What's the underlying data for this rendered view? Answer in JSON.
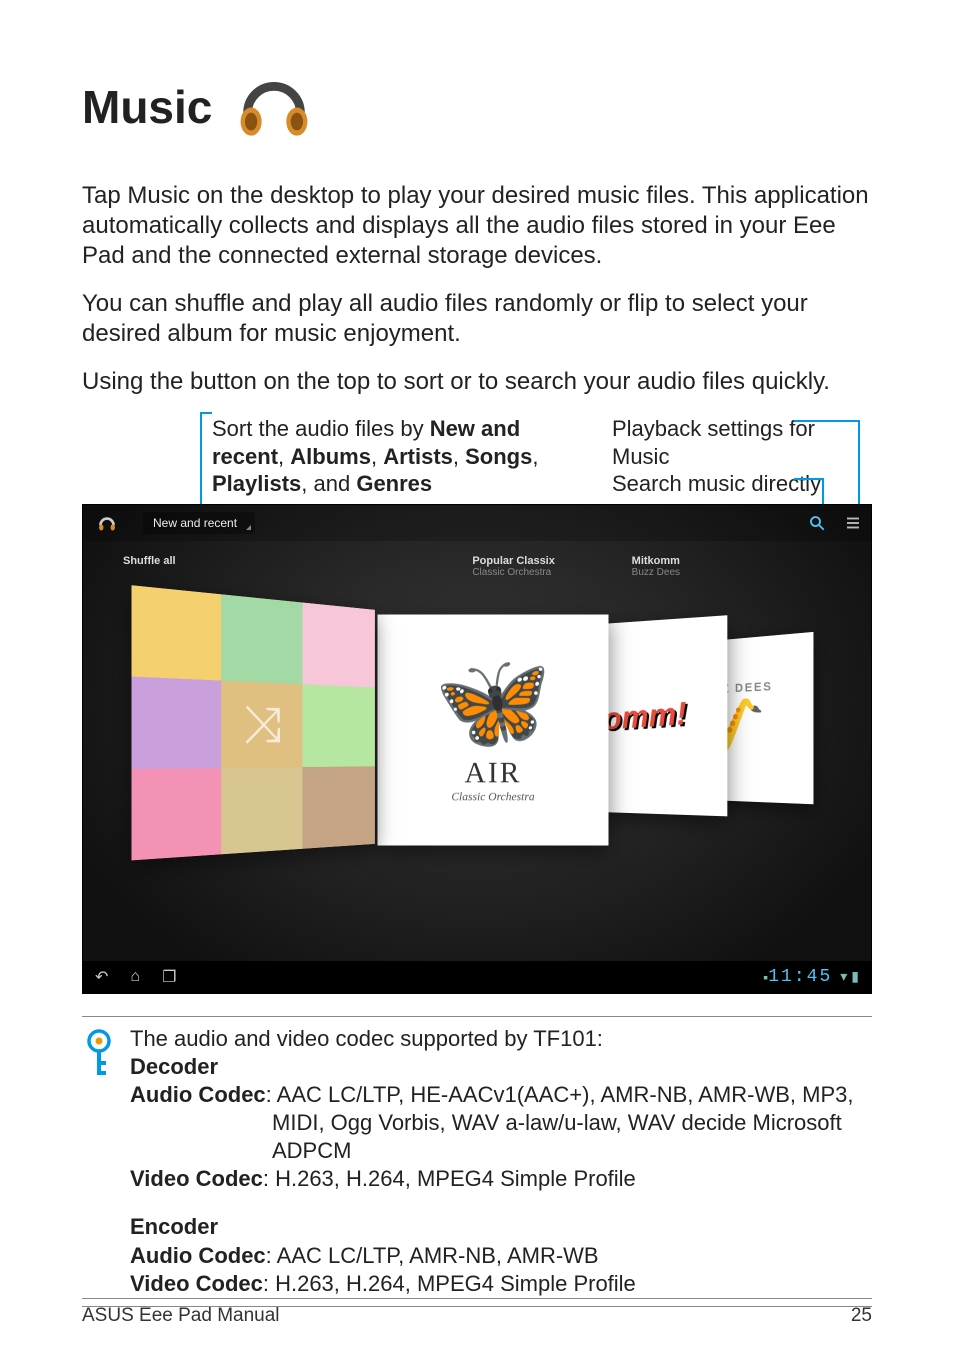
{
  "title": "Music",
  "paragraphs": {
    "p1": "Tap Music on the desktop to play your desired music files. This application automatically collects and displays all the audio files stored in your Eee Pad and the connected external storage devices.",
    "p2": "You can shuffle and play all audio files randomly or flip to select your desired album for music enjoyment.",
    "p3": "Using the button on the top to sort or to search your audio files quickly."
  },
  "callouts": {
    "sort_prefix": "Sort the audio files by ",
    "sort_bold1": "New and recent",
    "sort_sep1": ", ",
    "sort_bold2": "Albums",
    "sort_sep2": ", ",
    "sort_bold3": "Artists",
    "sort_sep3": ", ",
    "sort_bold4": "Songs",
    "sort_sep4": ", ",
    "sort_bold5": "Playlists",
    "sort_sep5": ", and ",
    "sort_bold6": "Genres",
    "playback": "Playback settings for Music",
    "search": "Search music directly"
  },
  "screenshot": {
    "dropdown": "New and recent",
    "labels": {
      "l1_title": "Shuffle all",
      "l1_sub": "",
      "l2_title": "Popular Classix",
      "l2_sub": "Classic Orchestra",
      "l3_title": "Mitkomm",
      "l3_sub": "Buzz Dees"
    },
    "covers": {
      "c2_brand": "AIR",
      "c2_sub": "Classic Orchestra",
      "c3_text": "tkomm!",
      "c4_band": "BUZZ DEES"
    },
    "clock": "11:45"
  },
  "note": {
    "intro": "The audio and video codec supported by TF101:",
    "decoder_label": "Decoder",
    "dec_audio_label": "Audio Codec",
    "dec_audio_val_l1": ": AAC LC/LTP, HE-AACv1(AAC+), AMR-NB, AMR-WB, MP3,",
    "dec_audio_val_l2": "MIDI, Ogg Vorbis, WAV a-law/u-law, WAV decide Microsoft",
    "dec_audio_val_l3": "ADPCM",
    "dec_video_label": "Video Codec",
    "dec_video_val": ": H.263, H.264, MPEG4 Simple Profile",
    "encoder_label": "Encoder",
    "enc_audio_label": "Audio Codec",
    "enc_audio_val": ": AAC LC/LTP, AMR-NB, AMR-WB",
    "enc_video_label": "Video Codec",
    "enc_video_val": ": H.263, H.264, MPEG4 Simple Profile"
  },
  "footer": {
    "left": "ASUS Eee Pad Manual",
    "right": "25"
  }
}
